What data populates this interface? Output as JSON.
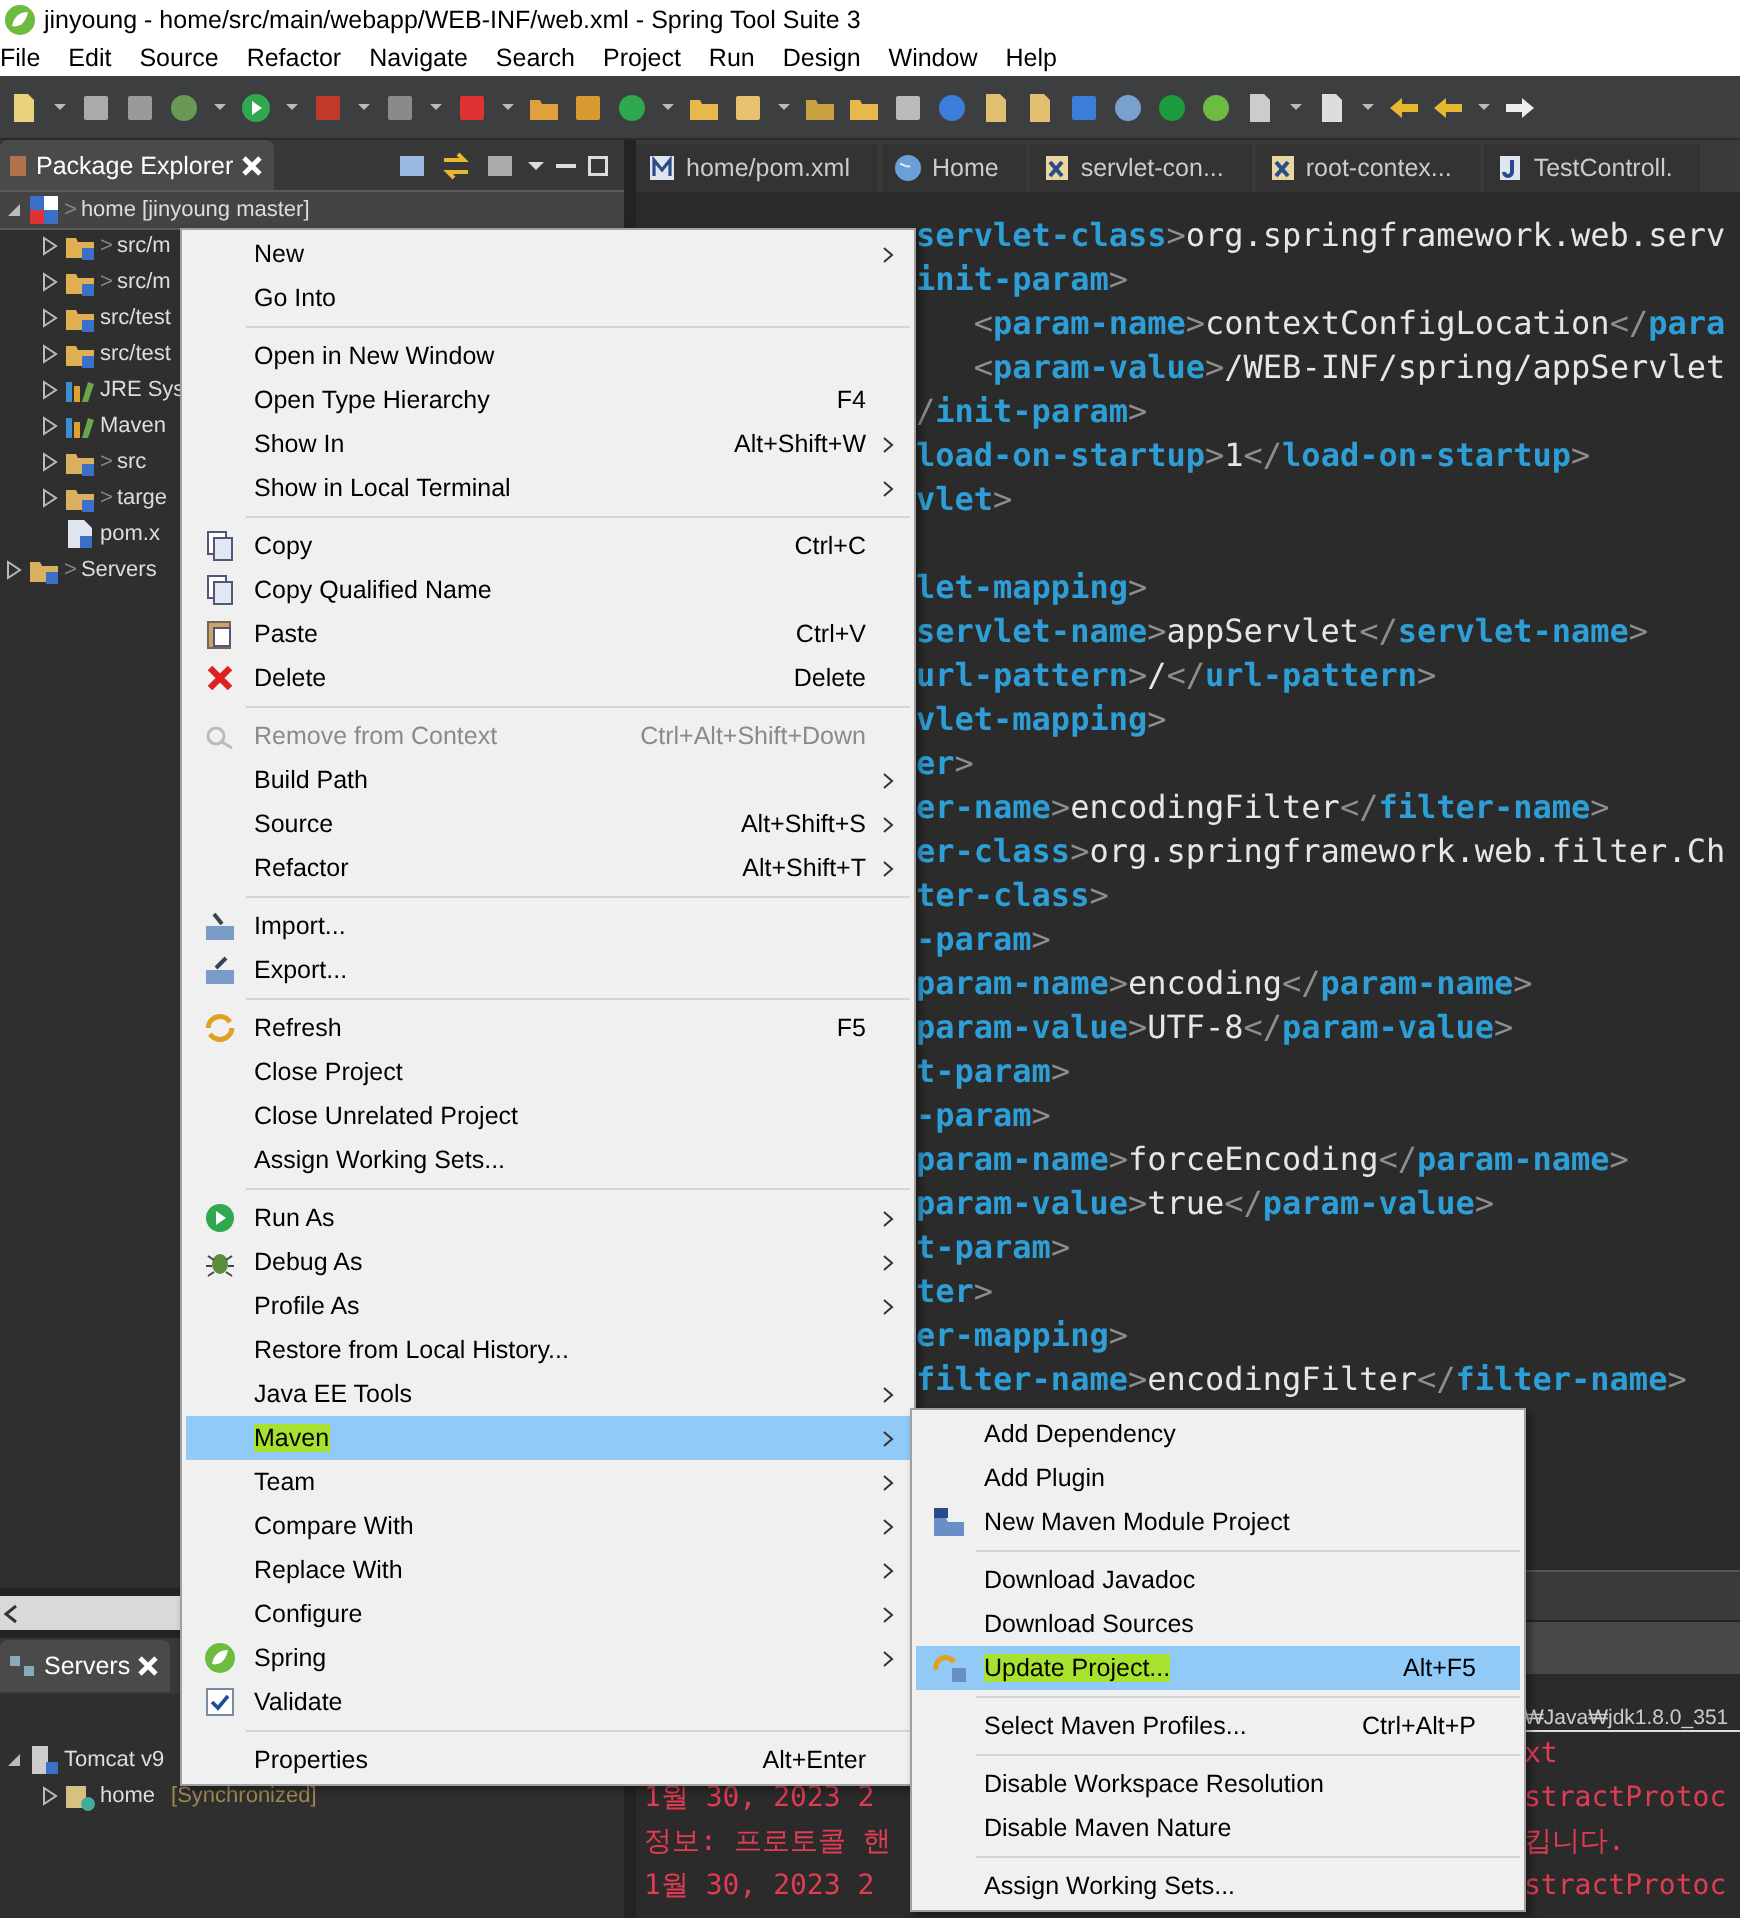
{
  "window": {
    "title": "jinyoung - home/src/main/webapp/WEB-INF/web.xml - Spring Tool Suite 3"
  },
  "menubar": [
    "File",
    "Edit",
    "Source",
    "Refactor",
    "Navigate",
    "Search",
    "Project",
    "Run",
    "Design",
    "Window",
    "Help"
  ],
  "package_explorer": {
    "title": "Package Explorer",
    "tree": [
      {
        "label": "home [jinyoung master]",
        "decoration": ">",
        "kind": "project",
        "expanded": true,
        "selected": true,
        "children": [
          {
            "label": "src/m",
            "decoration": ">",
            "kind": "source",
            "expanded": false,
            "selected": false
          },
          {
            "label": "src/m",
            "decoration": ">",
            "kind": "source",
            "expanded": false,
            "selected": false
          },
          {
            "label": "src/test",
            "kind": "source",
            "expanded": false,
            "selected": false
          },
          {
            "label": "src/test",
            "kind": "source",
            "expanded": false,
            "selected": false
          },
          {
            "label": "JRE Sys",
            "kind": "library",
            "expanded": false,
            "selected": false
          },
          {
            "label": "Maven",
            "kind": "library",
            "expanded": false,
            "selected": false
          },
          {
            "label": "src",
            "decoration": ">",
            "kind": "folder",
            "expanded": false,
            "selected": false
          },
          {
            "label": "targe",
            "decoration": ">",
            "kind": "folder",
            "expanded": false,
            "selected": false
          },
          {
            "label": "pom.x",
            "kind": "file",
            "expanded": false,
            "selected": false
          }
        ]
      },
      {
        "label": "Servers",
        "decoration": ">",
        "kind": "folder",
        "expanded": false,
        "selected": false
      }
    ]
  },
  "servers": {
    "title": "Servers",
    "tree": [
      {
        "label": "Tomcat v9",
        "kind": "server",
        "expanded": true,
        "children": [
          {
            "label": "home",
            "status": "[Synchronized]",
            "kind": "module",
            "expanded": false
          }
        ]
      }
    ]
  },
  "editor": {
    "tabs": [
      {
        "label": "home/pom.xml",
        "kind": "maven"
      },
      {
        "label": "Home",
        "kind": "web"
      },
      {
        "label": "servlet-con...",
        "kind": "xml"
      },
      {
        "label": "root-contex...",
        "kind": "xml"
      },
      {
        "label": "TestControll.",
        "kind": "java"
      }
    ],
    "code_blocks": [
      [
        "servlet-class>org.springframework.web.serv",
        "init-param>",
        "   <param-name>contextConfigLocation</para",
        "   <param-value>/WEB-INF/spring/appServlet",
        "/init-param>",
        "load-on-startup>1</load-on-startup>",
        "vlet>"
      ],
      [
        "let-mapping>",
        "servlet-name>appServlet</servlet-name>",
        "url-pattern>/</url-pattern>",
        "vlet-mapping>",
        "er>",
        "er-name>encodingFilter</filter-name>",
        "er-class>org.springframework.web.filter.Ch",
        "ter-class>",
        "-param>",
        "param-name>encoding</param-name>",
        "param-value>UTF-8</param-value>",
        "t-param>",
        "-param>",
        "param-name>forceEncoding</param-name>",
        "param-value>true</param-value>",
        "t-param>",
        "ter>",
        "er-mapping>",
        "filter-name>encodingFilter</filter-name>"
      ]
    ]
  },
  "console": {
    "header": "₩Java₩jdk1.8.0_351",
    "lines": [
      {
        "right": "xt"
      },
      {
        "left": "1월 30, 2023 2",
        "right": "stractProtoc"
      },
      {
        "left": "정보: 프로토콜 핸",
        "right": "킵니다."
      },
      {
        "left": "1월 30, 2023 2",
        "right": "stractProtoc"
      }
    ]
  },
  "context_menu": {
    "groups": [
      [
        {
          "label": "New",
          "submenu": true,
          "selected": false,
          "disabled": false,
          "marked": false
        },
        {
          "label": "Go Into",
          "submenu": false,
          "selected": false,
          "disabled": false,
          "marked": false
        }
      ],
      [
        {
          "label": "Open in New Window",
          "submenu": false,
          "selected": false,
          "disabled": false,
          "marked": false
        },
        {
          "label": "Open Type Hierarchy",
          "shortcut": "F4",
          "submenu": false,
          "selected": false,
          "disabled": false,
          "marked": false
        },
        {
          "label": "Show In",
          "shortcut": "Alt+Shift+W",
          "submenu": true,
          "selected": false,
          "disabled": false,
          "marked": false
        },
        {
          "label": "Show in Local Terminal",
          "submenu": true,
          "selected": false,
          "disabled": false,
          "marked": false
        }
      ],
      [
        {
          "label": "Copy",
          "shortcut": "Ctrl+C",
          "submenu": false,
          "selected": false,
          "disabled": false,
          "marked": false
        },
        {
          "label": "Copy Qualified Name",
          "submenu": false,
          "selected": false,
          "disabled": false,
          "marked": false
        },
        {
          "label": "Paste",
          "shortcut": "Ctrl+V",
          "submenu": false,
          "selected": false,
          "disabled": false,
          "marked": false
        },
        {
          "label": "Delete",
          "shortcut": "Delete",
          "submenu": false,
          "selected": false,
          "disabled": false,
          "marked": false
        }
      ],
      [
        {
          "label": "Remove from Context",
          "shortcut": "Ctrl+Alt+Shift+Down",
          "submenu": false,
          "selected": false,
          "disabled": true,
          "marked": false
        },
        {
          "label": "Build Path",
          "submenu": true,
          "selected": false,
          "disabled": false,
          "marked": false
        },
        {
          "label": "Source",
          "shortcut": "Alt+Shift+S",
          "submenu": true,
          "selected": false,
          "disabled": false,
          "marked": false
        },
        {
          "label": "Refactor",
          "shortcut": "Alt+Shift+T",
          "submenu": true,
          "selected": false,
          "disabled": false,
          "marked": false
        }
      ],
      [
        {
          "label": "Import...",
          "submenu": false,
          "selected": false,
          "disabled": false,
          "marked": false
        },
        {
          "label": "Export...",
          "submenu": false,
          "selected": false,
          "disabled": false,
          "marked": false
        }
      ],
      [
        {
          "label": "Refresh",
          "shortcut": "F5",
          "submenu": false,
          "selected": false,
          "disabled": false,
          "marked": false
        },
        {
          "label": "Close Project",
          "submenu": false,
          "selected": false,
          "disabled": false,
          "marked": false
        },
        {
          "label": "Close Unrelated Project",
          "submenu": false,
          "selected": false,
          "disabled": false,
          "marked": false
        },
        {
          "label": "Assign Working Sets...",
          "submenu": false,
          "selected": false,
          "disabled": false,
          "marked": false
        }
      ],
      [
        {
          "label": "Run As",
          "submenu": true,
          "selected": false,
          "disabled": false,
          "marked": false
        },
        {
          "label": "Debug As",
          "submenu": true,
          "selected": false,
          "disabled": false,
          "marked": false
        },
        {
          "label": "Profile As",
          "submenu": true,
          "selected": false,
          "disabled": false,
          "marked": false
        },
        {
          "label": "Restore from Local History...",
          "submenu": false,
          "selected": false,
          "disabled": false,
          "marked": false
        },
        {
          "label": "Java EE Tools",
          "submenu": true,
          "selected": false,
          "disabled": false,
          "marked": false
        },
        {
          "label": "Maven",
          "submenu": true,
          "selected": true,
          "disabled": false,
          "marked": true
        },
        {
          "label": "Team",
          "submenu": true,
          "selected": false,
          "disabled": false,
          "marked": false
        },
        {
          "label": "Compare With",
          "submenu": true,
          "selected": false,
          "disabled": false,
          "marked": false
        },
        {
          "label": "Replace With",
          "submenu": true,
          "selected": false,
          "disabled": false,
          "marked": false
        },
        {
          "label": "Configure",
          "submenu": true,
          "selected": false,
          "disabled": false,
          "marked": false
        },
        {
          "label": "Spring",
          "submenu": true,
          "selected": false,
          "disabled": false,
          "marked": false
        },
        {
          "label": "Validate",
          "checked": true,
          "submenu": false,
          "selected": false,
          "disabled": false,
          "marked": false
        }
      ],
      [
        {
          "label": "Properties",
          "shortcut": "Alt+Enter",
          "submenu": false,
          "selected": false,
          "disabled": false,
          "marked": false
        }
      ]
    ]
  },
  "maven_submenu": {
    "groups": [
      [
        {
          "label": "Add Dependency",
          "selected": false,
          "marked": false
        },
        {
          "label": "Add Plugin",
          "selected": false,
          "marked": false
        },
        {
          "label": "New Maven Module Project",
          "selected": false,
          "marked": false
        }
      ],
      [
        {
          "label": "Download Javadoc",
          "selected": false,
          "marked": false
        },
        {
          "label": "Download Sources",
          "selected": false,
          "marked": false
        },
        {
          "label": "Update Project...",
          "shortcut": "Alt+F5",
          "selected": true,
          "marked": true
        }
      ],
      [
        {
          "label": "Select Maven Profiles...",
          "shortcut": "Ctrl+Alt+P",
          "selected": false,
          "marked": false
        }
      ],
      [
        {
          "label": "Disable Workspace Resolution",
          "selected": false,
          "marked": false
        },
        {
          "label": "Disable Maven Nature",
          "selected": false,
          "marked": false
        }
      ],
      [
        {
          "label": "Assign Working Sets...",
          "selected": false,
          "marked": false
        }
      ]
    ]
  }
}
